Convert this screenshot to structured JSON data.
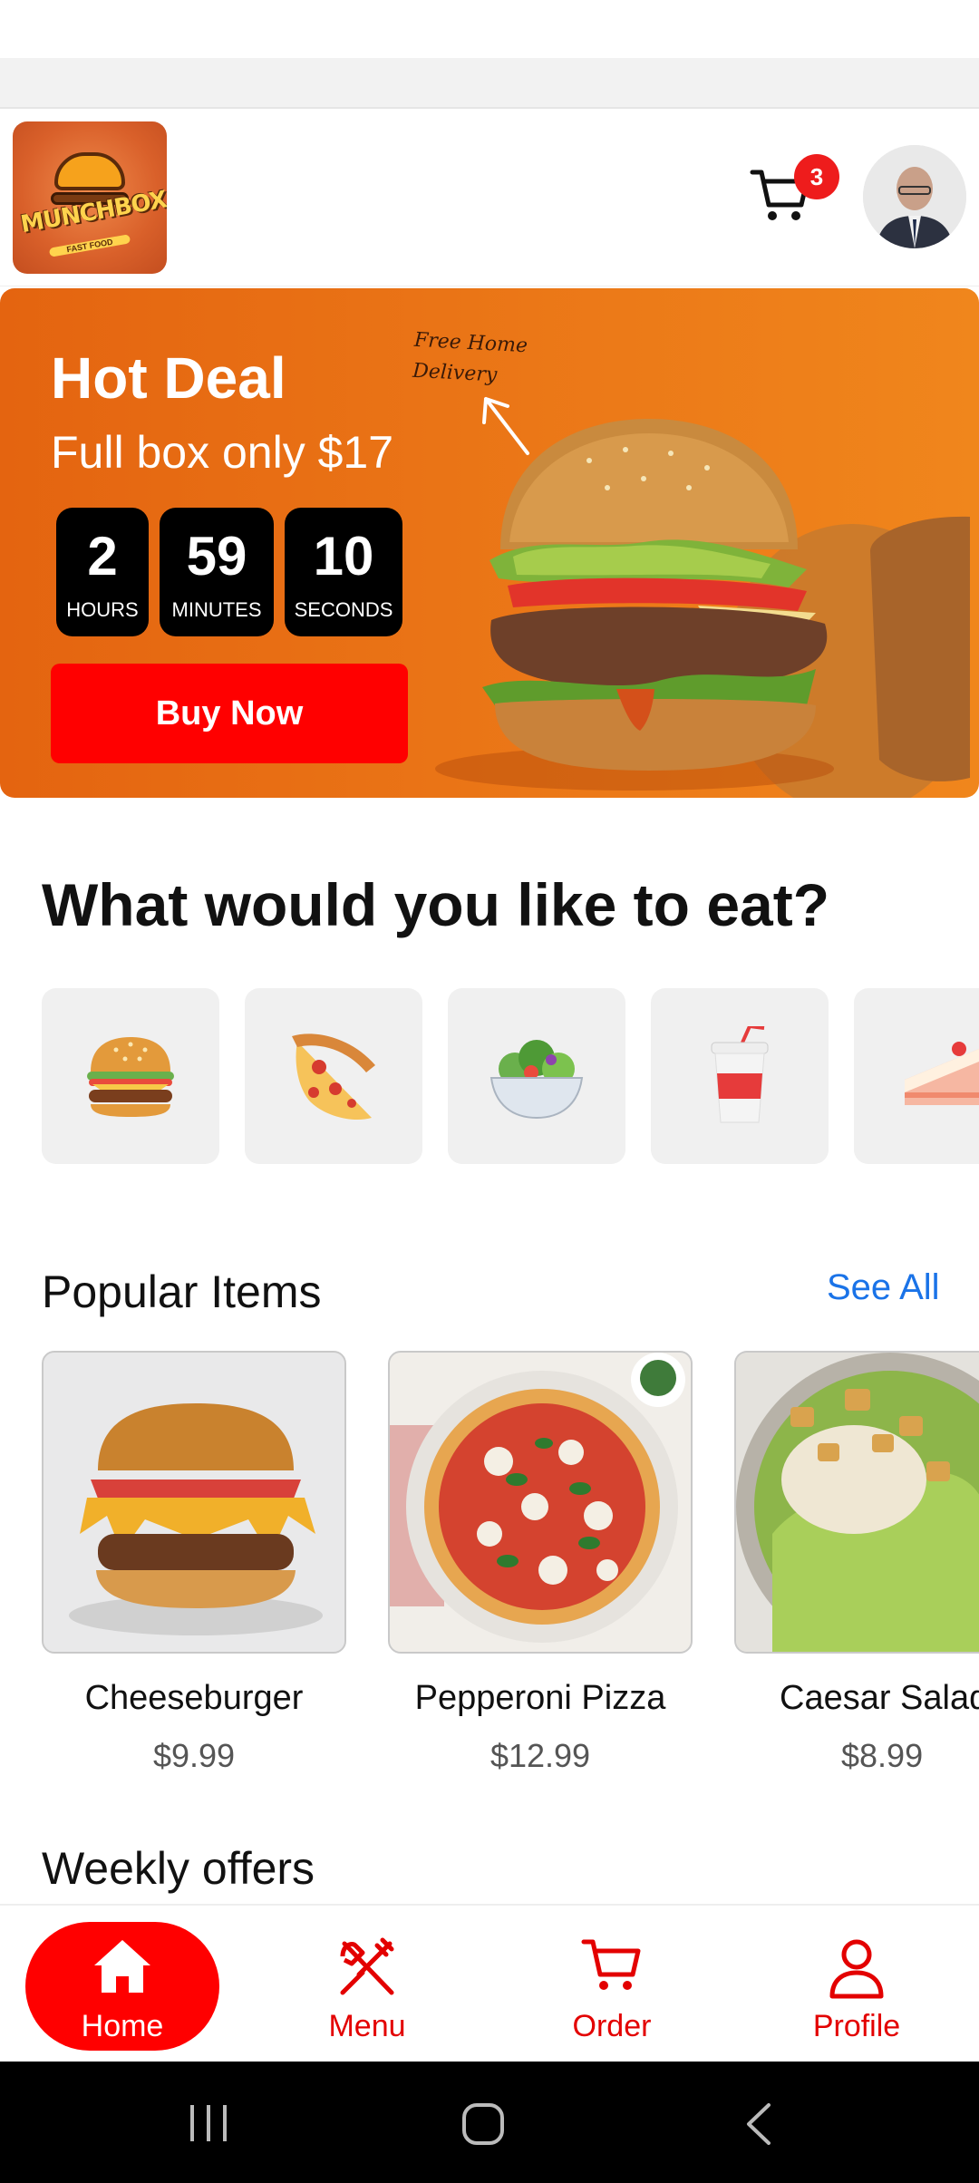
{
  "brand": {
    "logo_text": "MUNCHBOX",
    "logo_subtext": "FAST FOOD"
  },
  "header": {
    "cart_count": "3"
  },
  "hot_deal": {
    "title": "Hot Deal",
    "subtitle": "Full box only $17",
    "note_line1": "Free Home",
    "note_line2": "Delivery",
    "timer": [
      {
        "value": "2",
        "label": "HOURS"
      },
      {
        "value": "59",
        "label": "MINUTES"
      },
      {
        "value": "10",
        "label": "SECONDS"
      }
    ],
    "cta": "Buy Now"
  },
  "categories": {
    "heading": "What would you like to eat?",
    "items": [
      "🍔",
      "🍕",
      "🥗",
      "🥤",
      "🍰"
    ]
  },
  "popular": {
    "heading": "Popular Items",
    "see_all": "See All",
    "items": [
      {
        "name": "Cheeseburger",
        "price": "$9.99"
      },
      {
        "name": "Pepperoni Pizza",
        "price": "$12.99"
      },
      {
        "name": "Caesar Salad",
        "price": "$8.99"
      }
    ]
  },
  "weekly": {
    "heading": "Weekly offers"
  },
  "nav": {
    "items": [
      {
        "label": "Home",
        "icon": "home-icon"
      },
      {
        "label": "Menu",
        "icon": "utensils-icon"
      },
      {
        "label": "Order",
        "icon": "cart-icon"
      },
      {
        "label": "Profile",
        "icon": "user-icon"
      }
    ]
  },
  "colors": {
    "accent": "#ff0000",
    "banner": "#ea7416",
    "link": "#1a73e8"
  }
}
